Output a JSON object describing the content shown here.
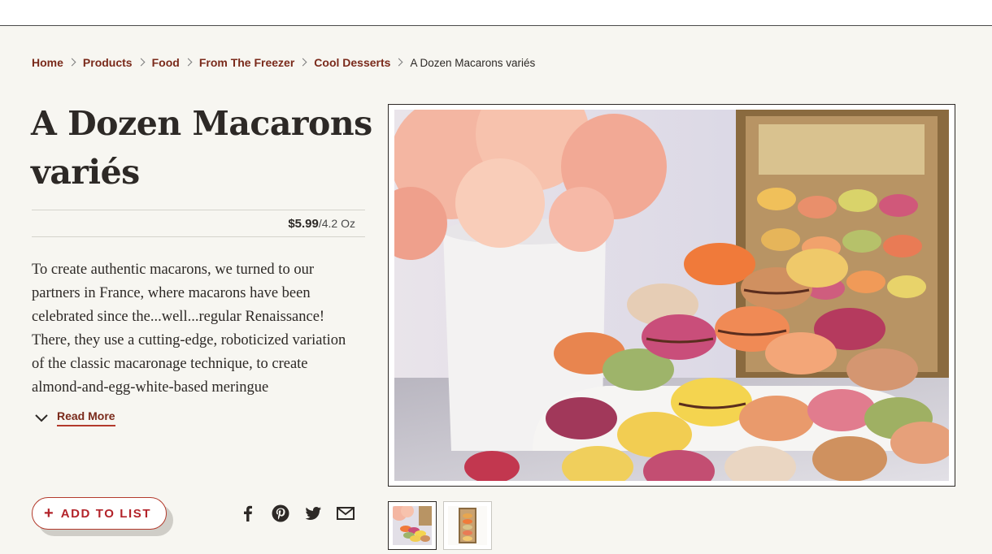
{
  "breadcrumb": {
    "items": [
      "Home",
      "Products",
      "Food",
      "From The Freezer",
      "Cool Desserts"
    ],
    "current": "A Dozen Macarons variés"
  },
  "product": {
    "title_line1": "A Dozen Macarons",
    "title_line2": "variés",
    "price": "$5.99",
    "unit": "/4.2 Oz",
    "description": "To create authentic macarons, we turned to our partners in France, where macarons have been celebrated since the...well...regular Renaissance! There, they use a cutting-edge, roboticized variation of the classic macaronage technique, to create almond-and-egg-white-based meringue"
  },
  "read_more_label": "Read More",
  "add_to_list": {
    "plus": "+",
    "label": "ADD TO LIST"
  },
  "social": [
    "facebook-icon",
    "pinterest-icon",
    "twitter-icon",
    "email-icon"
  ],
  "colors": {
    "link": "#7a2a1b",
    "accent": "#b3232a",
    "text": "#2d2926",
    "background": "#f7f6f1"
  }
}
